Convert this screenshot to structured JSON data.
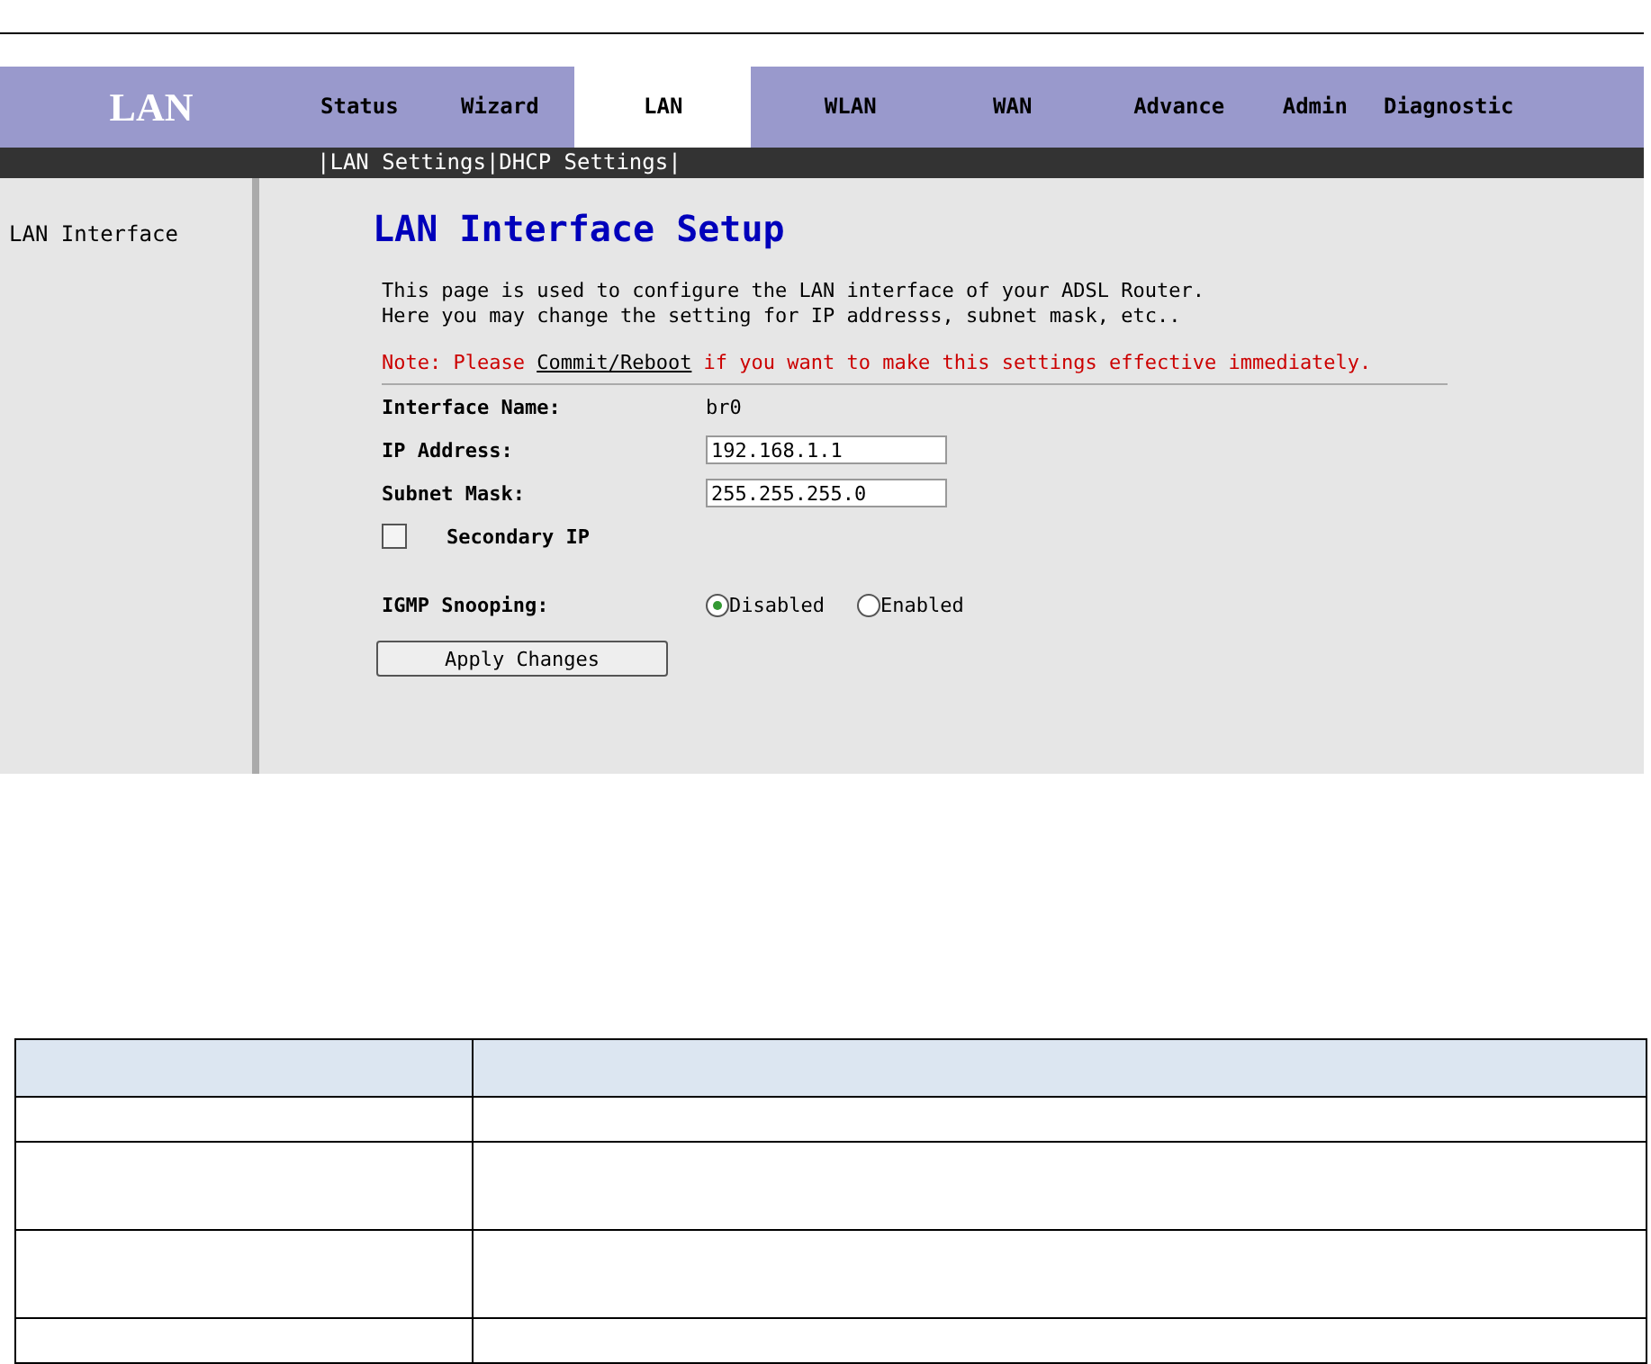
{
  "nav": {
    "logo": "LAN",
    "tabs": [
      {
        "label": "Status",
        "selected": false
      },
      {
        "label": "Wizard",
        "selected": false
      },
      {
        "label": "LAN",
        "selected": true
      },
      {
        "label": "WLAN",
        "selected": false
      },
      {
        "label": "WAN",
        "selected": false
      },
      {
        "label": "Advance",
        "selected": false
      },
      {
        "label": "Admin",
        "selected": false
      },
      {
        "label": "Diagnostic",
        "selected": false
      }
    ]
  },
  "submenu": {
    "separator": "|",
    "items": [
      "LAN Settings",
      "DHCP Settings"
    ]
  },
  "sidebar": {
    "items": [
      {
        "label": "LAN Interface"
      }
    ]
  },
  "content": {
    "title": "LAN Interface Setup",
    "description": [
      "This page is used to configure the LAN interface of your ADSL Router.",
      "Here you may change the setting for IP addresss, subnet mask, etc.."
    ],
    "note": {
      "before": "Note: Please ",
      "link": "Commit/Reboot",
      "after": " if you want to make this settings effective immediately."
    },
    "interface_name": {
      "label": "Interface Name:",
      "value": "br0"
    },
    "fields": [
      {
        "label": "IP Address:",
        "value": "192.168.1.1"
      },
      {
        "label": "Subnet Mask:",
        "value": "255.255.255.0"
      }
    ],
    "secondary_ip": {
      "label": "Secondary IP",
      "checked": false
    },
    "igmp": {
      "label": "IGMP Snooping:",
      "options": [
        {
          "label": "Disabled",
          "selected": true
        },
        {
          "label": "Enabled",
          "selected": false
        }
      ]
    },
    "apply_button": "Apply Changes"
  }
}
